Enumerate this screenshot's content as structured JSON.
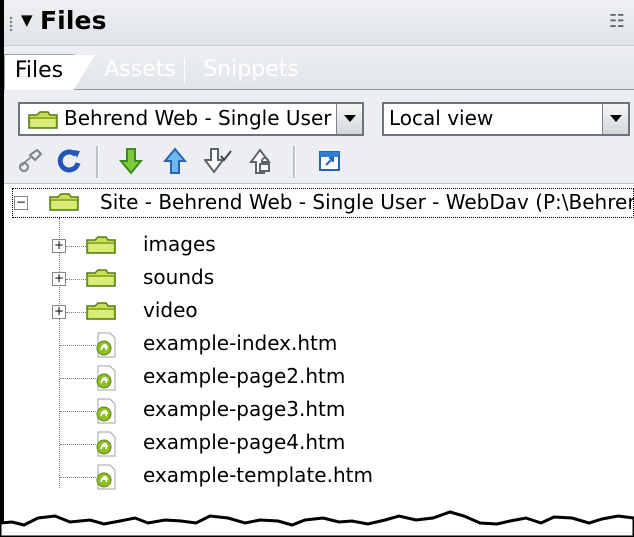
{
  "panel": {
    "title": "Files",
    "tabs": [
      {
        "label": "Files",
        "active": true
      },
      {
        "label": "Assets",
        "active": false
      },
      {
        "label": "Snippets",
        "active": false
      }
    ],
    "site_selector": {
      "selected": "Behrend Web - Single User - WebDav"
    },
    "view_selector": {
      "selected": "Local view"
    },
    "toolbar_icons": [
      "connect-icon",
      "refresh-icon",
      "get-files-icon",
      "put-files-icon",
      "check-out-icon",
      "check-in-icon",
      "expand-panel-icon"
    ]
  },
  "tree": {
    "root": "Site - Behrend Web - Single User - WebDav (P:\\Behrend",
    "folders": [
      {
        "name": "images"
      },
      {
        "name": "sounds"
      },
      {
        "name": "video"
      }
    ],
    "files": [
      {
        "name": "example-index.htm"
      },
      {
        "name": "example-page2.htm"
      },
      {
        "name": "example-page3.htm"
      },
      {
        "name": "example-page4.htm"
      },
      {
        "name": "example-template.htm"
      }
    ]
  },
  "colors": {
    "folder": "#b8d63a",
    "folder_dark": "#5f8414",
    "file": "#8fbf23",
    "panel": "#eceef1",
    "border": "#6c737d"
  }
}
